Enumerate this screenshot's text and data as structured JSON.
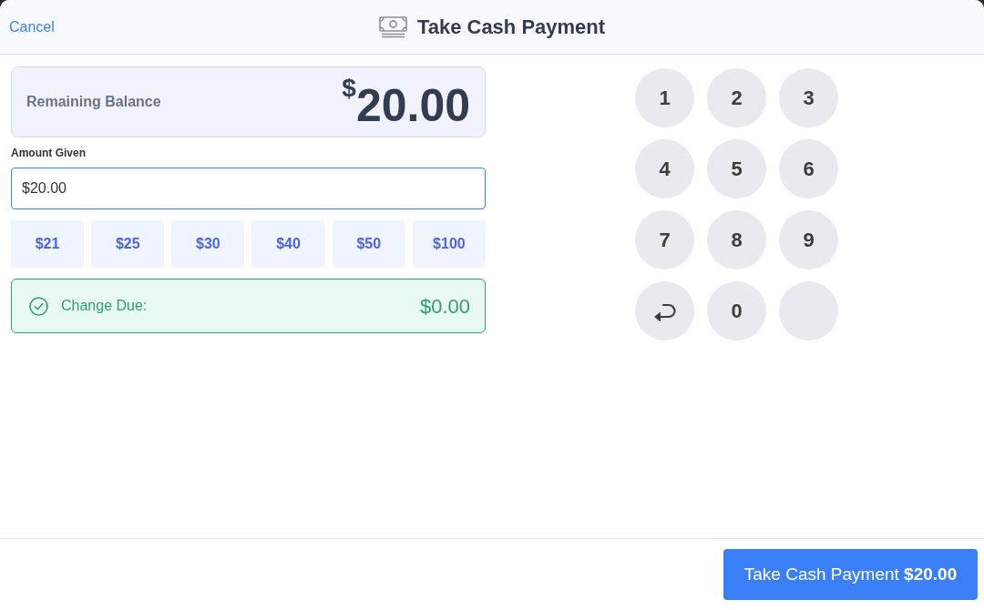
{
  "header": {
    "cancel": "Cancel",
    "title": "Take Cash Payment"
  },
  "balance": {
    "label": "Remaining Balance",
    "currency_symbol": "$",
    "amount": "20.00"
  },
  "amount_given": {
    "label": "Amount Given",
    "value": "$20.00",
    "focused": true
  },
  "quick_amounts": [
    "$21",
    "$25",
    "$30",
    "$40",
    "$50",
    "$100"
  ],
  "change_due": {
    "label": "Change Due:",
    "value": "$0.00"
  },
  "keypad": [
    {
      "kind": "digit",
      "label": "1"
    },
    {
      "kind": "digit",
      "label": "2"
    },
    {
      "kind": "digit",
      "label": "3"
    },
    {
      "kind": "digit",
      "label": "4"
    },
    {
      "kind": "digit",
      "label": "5"
    },
    {
      "kind": "digit",
      "label": "6"
    },
    {
      "kind": "digit",
      "label": "7"
    },
    {
      "kind": "digit",
      "label": "8"
    },
    {
      "kind": "digit",
      "label": "9"
    },
    {
      "kind": "back"
    },
    {
      "kind": "digit",
      "label": "0"
    },
    {
      "kind": "blank"
    }
  ],
  "footer": {
    "submit": "Take Cash Payment **$20.00**"
  }
}
